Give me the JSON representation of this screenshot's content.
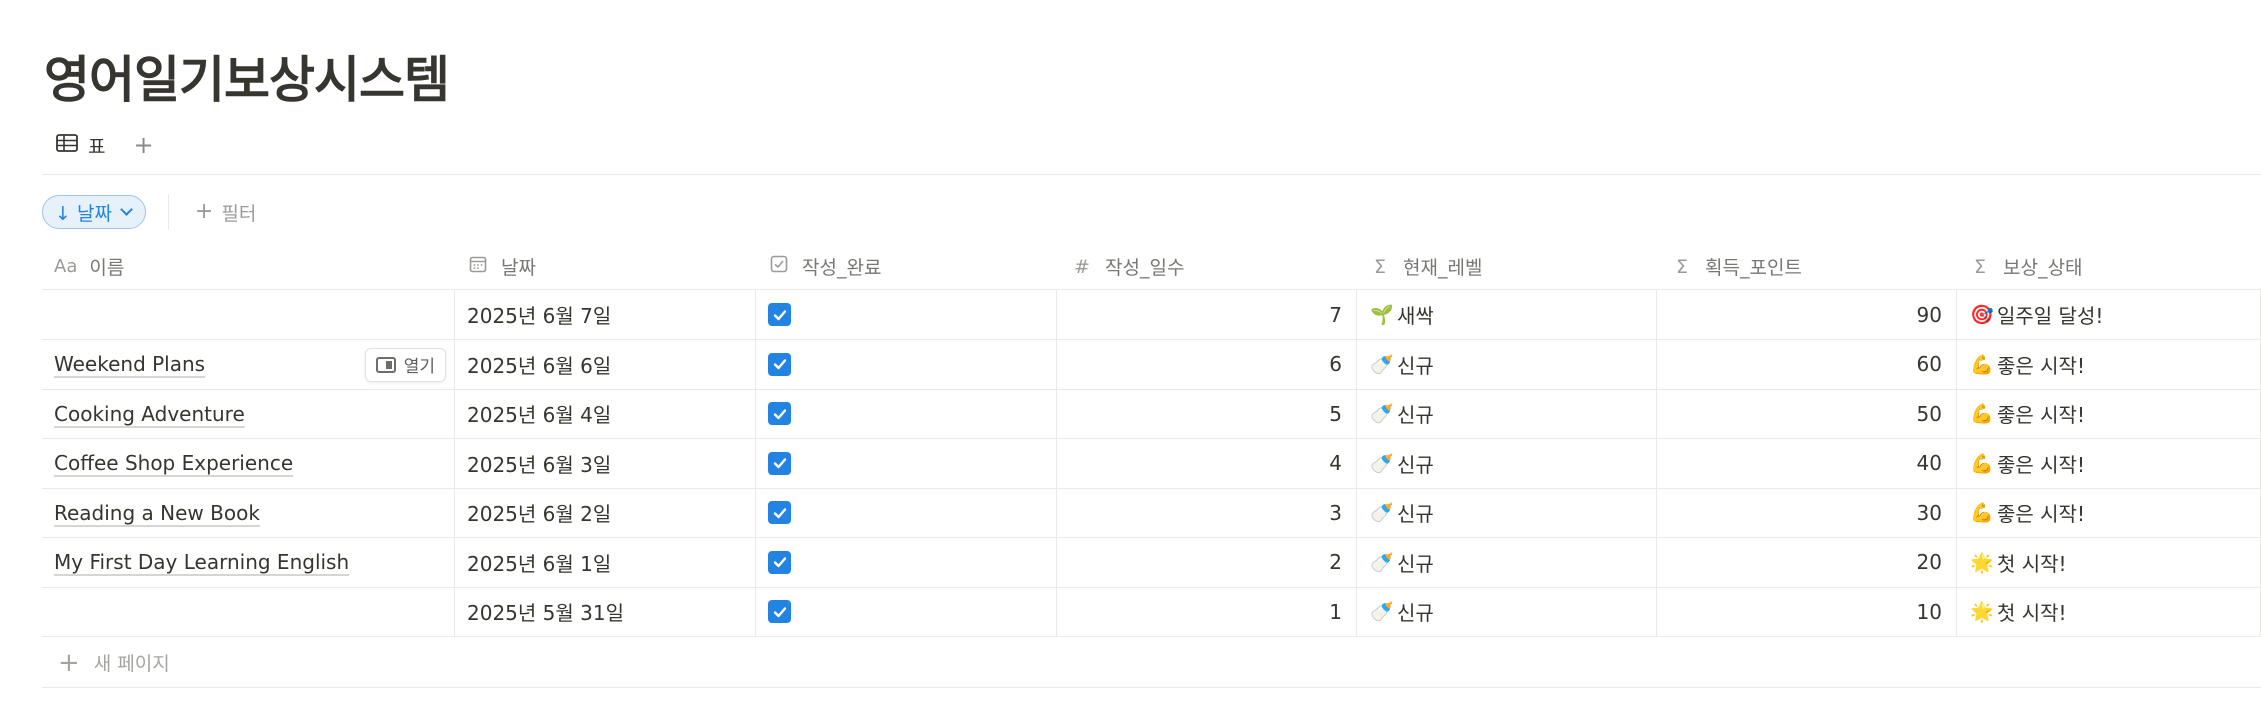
{
  "page": {
    "title": "영어일기보상시스템"
  },
  "views": {
    "tab_label": "표",
    "tab_icon": "table-icon",
    "add_icon": "plus-icon"
  },
  "toolbar": {
    "sort_label": "↓ 날짜",
    "filter_label": "필터"
  },
  "table": {
    "columns": [
      {
        "label": "이름",
        "icon": "Aa"
      },
      {
        "label": "날짜",
        "icon": "calendar-icon"
      },
      {
        "label": "작성_완료",
        "icon": "checkbox-icon"
      },
      {
        "label": "작성_일수",
        "icon": "#"
      },
      {
        "label": "현재_레벨",
        "icon": "Σ"
      },
      {
        "label": "획득_포인트",
        "icon": "Σ"
      },
      {
        "label": "보상_상태",
        "icon": "Σ"
      }
    ],
    "rows": [
      {
        "name": "",
        "date": "2025년 6월 7일",
        "done": true,
        "days": "7",
        "level_icon": "🌱",
        "level": "새싹",
        "points": "90",
        "status_icon": "🎯",
        "status": "일주일 달성!"
      },
      {
        "name": "Weekend Plans",
        "date": "2025년 6월 6일",
        "done": true,
        "days": "6",
        "level_icon": "🍼",
        "level": "신규",
        "points": "60",
        "status_icon": "💪",
        "status": "좋은 시작!"
      },
      {
        "name": "Cooking Adventure",
        "date": "2025년 6월 4일",
        "done": true,
        "days": "5",
        "level_icon": "🍼",
        "level": "신규",
        "points": "50",
        "status_icon": "💪",
        "status": "좋은 시작!"
      },
      {
        "name": "Coffee Shop Experience",
        "date": "2025년 6월 3일",
        "done": true,
        "days": "4",
        "level_icon": "🍼",
        "level": "신규",
        "points": "40",
        "status_icon": "💪",
        "status": "좋은 시작!"
      },
      {
        "name": "Reading a New Book",
        "date": "2025년 6월 2일",
        "done": true,
        "days": "3",
        "level_icon": "🍼",
        "level": "신규",
        "points": "30",
        "status_icon": "💪",
        "status": "좋은 시작!"
      },
      {
        "name": "My First Day Learning English",
        "date": "2025년 6월 1일",
        "done": true,
        "days": "2",
        "level_icon": "🍼",
        "level": "신규",
        "points": "20",
        "status_icon": "🌟",
        "status": "첫 시작!"
      },
      {
        "name": "",
        "date": "2025년 5월 31일",
        "done": true,
        "days": "1",
        "level_icon": "🍼",
        "level": "신규",
        "points": "10",
        "status_icon": "🌟",
        "status": "첫 시작!"
      }
    ],
    "hover_open_label": "열기",
    "new_page_label": "새 페이지"
  },
  "colors": {
    "accent": "#2383e2",
    "text": "#37352f",
    "muted": "#9b9a97",
    "border": "#e9e9e7"
  }
}
